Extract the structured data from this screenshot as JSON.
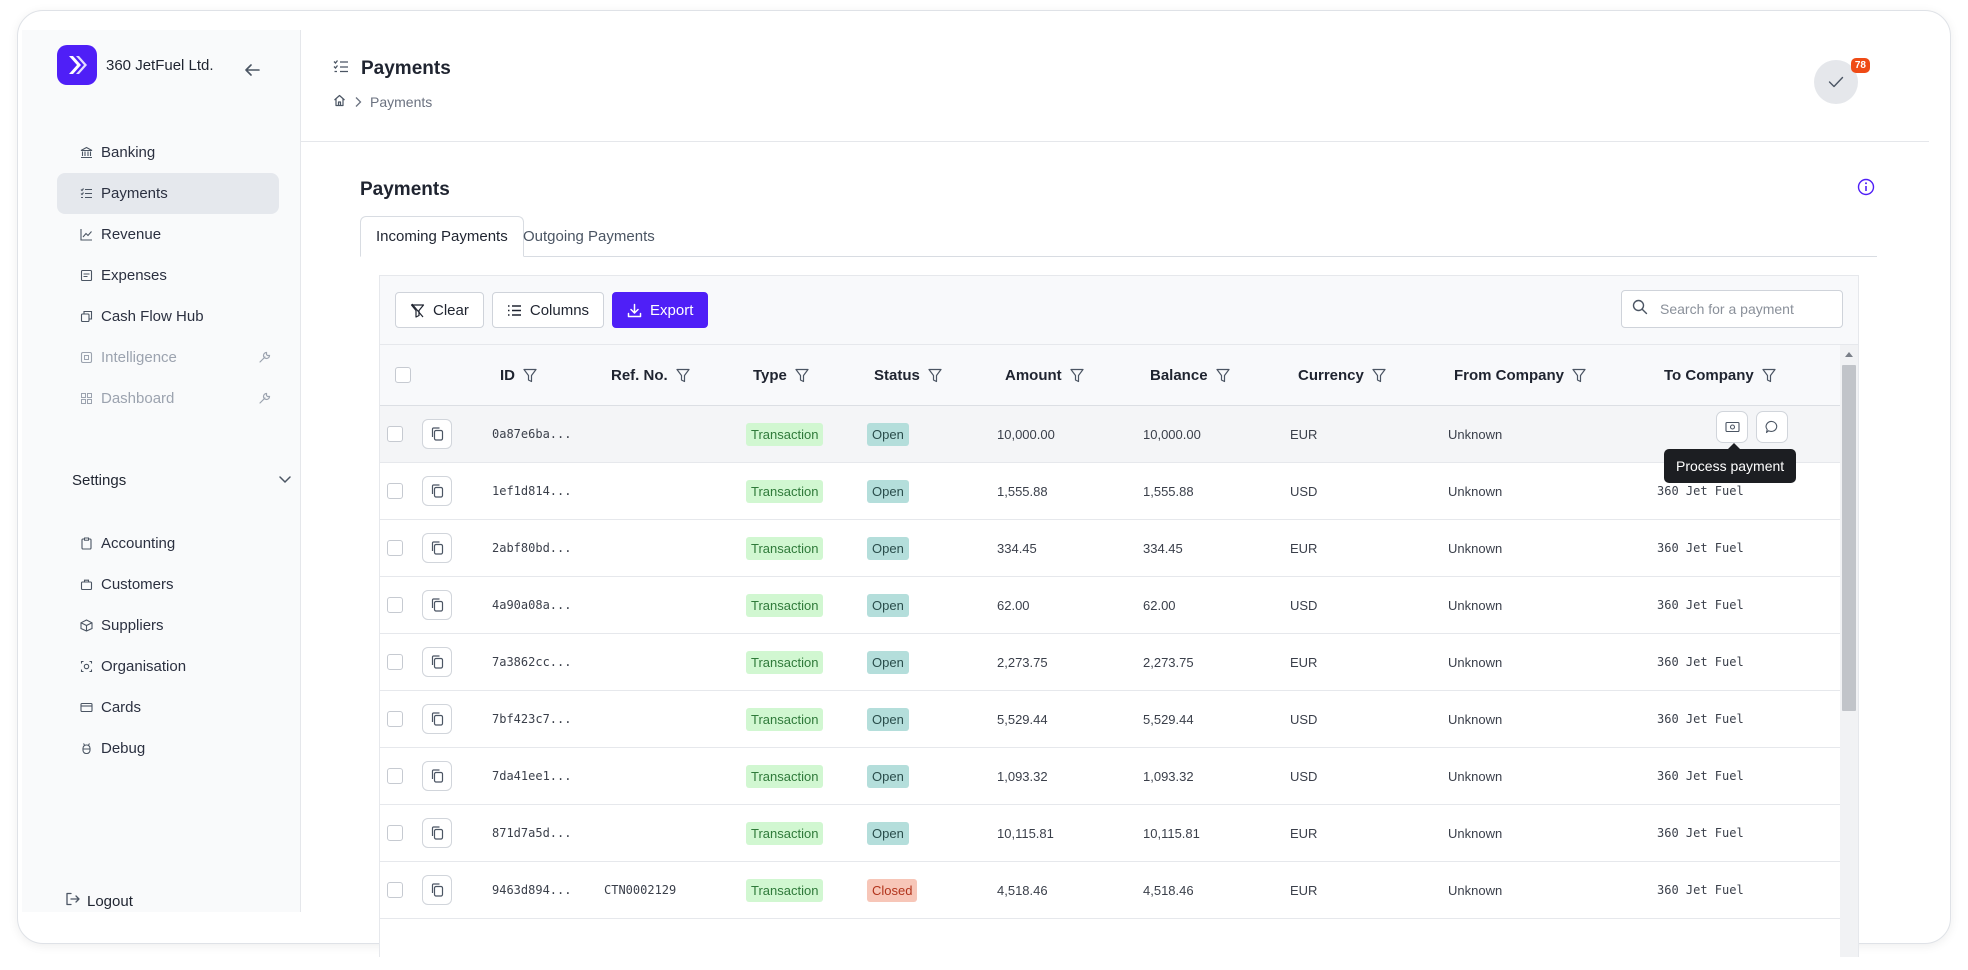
{
  "app": {
    "company": "360 JetFuel Ltd."
  },
  "sidebar": {
    "items": [
      {
        "label": "Banking",
        "icon": "bank-icon"
      },
      {
        "label": "Payments",
        "icon": "list-check-icon",
        "active": true
      },
      {
        "label": "Revenue",
        "icon": "chart-line-icon"
      },
      {
        "label": "Expenses",
        "icon": "receipt-icon"
      },
      {
        "label": "Cash Flow Hub",
        "icon": "stack-icon"
      },
      {
        "label": "Intelligence",
        "icon": "grid-icon",
        "disabled": true
      },
      {
        "label": "Dashboard",
        "icon": "dashboard-icon",
        "disabled": true
      }
    ],
    "settings_label": "Settings",
    "settings_items": [
      {
        "label": "Accounting",
        "icon": "clipboard-icon"
      },
      {
        "label": "Customers",
        "icon": "briefcase-icon"
      },
      {
        "label": "Suppliers",
        "icon": "package-icon"
      },
      {
        "label": "Organisation",
        "icon": "organisation-icon"
      },
      {
        "label": "Cards",
        "icon": "card-icon"
      },
      {
        "label": "Debug",
        "icon": "bug-icon"
      }
    ],
    "logout_label": "Logout"
  },
  "header": {
    "title": "Payments",
    "breadcrumb": {
      "current": "Payments"
    },
    "notifications_count": "78"
  },
  "main": {
    "section_title": "Payments",
    "tabs": [
      {
        "label": "Incoming Payments",
        "active": true
      },
      {
        "label": "Outgoing Payments",
        "active": false
      }
    ],
    "toolbar": {
      "clear_label": "Clear",
      "columns_label": "Columns",
      "export_label": "Export"
    },
    "search": {
      "placeholder": "Search for a payment"
    },
    "tooltip": "Process payment"
  },
  "table": {
    "columns": [
      "ID",
      "Ref. No.",
      "Type",
      "Status",
      "Amount",
      "Balance",
      "Currency",
      "From Company",
      "To Company"
    ],
    "rows": [
      {
        "id": "0a87e6ba...",
        "ref": "",
        "type": "Transaction",
        "status": "Open",
        "amount": "10,000.00",
        "balance": "10,000.00",
        "currency": "EUR",
        "from": "Unknown",
        "to": ""
      },
      {
        "id": "1ef1d814...",
        "ref": "",
        "type": "Transaction",
        "status": "Open",
        "amount": "1,555.88",
        "balance": "1,555.88",
        "currency": "USD",
        "from": "Unknown",
        "to": "360 Jet Fuel"
      },
      {
        "id": "2abf80bd...",
        "ref": "",
        "type": "Transaction",
        "status": "Open",
        "amount": "334.45",
        "balance": "334.45",
        "currency": "EUR",
        "from": "Unknown",
        "to": "360 Jet Fuel"
      },
      {
        "id": "4a90a08a...",
        "ref": "",
        "type": "Transaction",
        "status": "Open",
        "amount": "62.00",
        "balance": "62.00",
        "currency": "USD",
        "from": "Unknown",
        "to": "360 Jet Fuel"
      },
      {
        "id": "7a3862cc...",
        "ref": "",
        "type": "Transaction",
        "status": "Open",
        "amount": "2,273.75",
        "balance": "2,273.75",
        "currency": "EUR",
        "from": "Unknown",
        "to": "360 Jet Fuel"
      },
      {
        "id": "7bf423c7...",
        "ref": "",
        "type": "Transaction",
        "status": "Open",
        "amount": "5,529.44",
        "balance": "5,529.44",
        "currency": "USD",
        "from": "Unknown",
        "to": "360 Jet Fuel"
      },
      {
        "id": "7da41ee1...",
        "ref": "",
        "type": "Transaction",
        "status": "Open",
        "amount": "1,093.32",
        "balance": "1,093.32",
        "currency": "USD",
        "from": "Unknown",
        "to": "360 Jet Fuel"
      },
      {
        "id": "871d7a5d...",
        "ref": "",
        "type": "Transaction",
        "status": "Open",
        "amount": "10,115.81",
        "balance": "10,115.81",
        "currency": "EUR",
        "from": "Unknown",
        "to": "360 Jet Fuel"
      },
      {
        "id": "9463d894...",
        "ref": "CTN0002129",
        "type": "Transaction",
        "status": "Closed",
        "amount": "4,518.46",
        "balance": "4,518.46",
        "currency": "EUR",
        "from": "Unknown",
        "to": "360 Jet Fuel"
      }
    ]
  },
  "colors": {
    "accent": "#4f1ff7",
    "badge": "#ef4b16",
    "open_tag": "#b4dedb",
    "closed_tag": "#f7c6b8",
    "transaction_tag": "#d1f7d1"
  }
}
